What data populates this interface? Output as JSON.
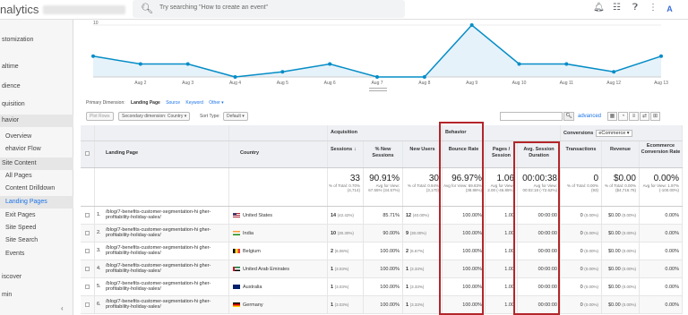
{
  "app": {
    "title": "nalytics",
    "search_placeholder": "Try searching \"How to create an event\"",
    "avatar_initials": "A"
  },
  "sidebar": {
    "items": [
      {
        "label": "stomization",
        "type": "item"
      },
      {
        "label": "altime",
        "type": "item"
      },
      {
        "label": "dience",
        "type": "item"
      },
      {
        "label": "quisition",
        "type": "item"
      },
      {
        "label": "havior",
        "type": "section"
      },
      {
        "label": "Overview",
        "type": "sub"
      },
      {
        "label": "ehavior Flow",
        "type": "sub"
      },
      {
        "label": "Site Content",
        "type": "section"
      },
      {
        "label": "All Pages",
        "type": "sub2"
      },
      {
        "label": "Content Drilldown",
        "type": "sub2"
      },
      {
        "label": "Landing Pages",
        "type": "active"
      },
      {
        "label": "Exit Pages",
        "type": "sub2"
      },
      {
        "label": "Site Speed",
        "type": "sub"
      },
      {
        "label": "Site Search",
        "type": "sub"
      },
      {
        "label": "Events",
        "type": "sub"
      },
      {
        "label": "iscover",
        "type": "item"
      },
      {
        "label": "min",
        "type": "item"
      }
    ]
  },
  "chart_data": {
    "type": "line",
    "categories": [
      "",
      "Aug 2",
      "Aug 3",
      "Aug 4",
      "Aug 5",
      "Aug 6",
      "Aug 7",
      "Aug 8",
      "Aug 9",
      "Aug 10",
      "Aug 11",
      "Aug 12",
      "Aug 13"
    ],
    "values": [
      4,
      2.5,
      2.5,
      0,
      1,
      2.5,
      0,
      0,
      10,
      2.5,
      2.5,
      1,
      4
    ],
    "ytick": "10",
    "ylim": [
      0,
      10
    ],
    "color": "#058dc7",
    "fill": "#e6f2f9"
  },
  "controls": {
    "primary_dimension": "Primary Dimension:",
    "landing_page": "Landing Page",
    "source": "Source",
    "keyword": "Keyword",
    "other": "Other ▾",
    "plot_rows": "Plot Rows",
    "secondary_dimension": "Secondary dimension: Country ▾",
    "sort_type_label": "Sort Type:",
    "sort_type_value": "Default ▾",
    "advanced": "advanced"
  },
  "table": {
    "headers": {
      "landing_page": "Landing Page",
      "country": "Country",
      "acquisition": "Acquisition",
      "behavior": "Behavior",
      "conversions": "Conversions",
      "ecommerce_sel": "eCommerce ▾",
      "sessions": "Sessions",
      "new_sessions": "% New Sessions",
      "new_users": "New Users",
      "bounce_rate": "Bounce Rate",
      "pages_session": "Pages / Session",
      "avg_session": "Avg. Session Duration",
      "transactions": "Transactions",
      "revenue": "Revenue",
      "ecommerce_rate": "Ecommerce Conversion Rate"
    },
    "totals": {
      "sessions": {
        "value": "33",
        "sub": "% of Total: 0.70% (4,714)"
      },
      "new_sessions": {
        "value": "90.91%",
        "sub": "Avg for View: 67.55% (34.57%)"
      },
      "new_users": {
        "value": "30",
        "sub": "% of Total: 0.94% (3,170)"
      },
      "bounce_rate": {
        "value": "96.97%",
        "sub": "Avg for View: 69.83% (38.86%)"
      },
      "pages_session": {
        "value": "1.06",
        "sub": "Avg for View: 2.00 (-46.85%)"
      },
      "avg_session": {
        "value": "00:00:38",
        "sub": "Avg for View: 00:02:18 (-72.62%)"
      },
      "transactions": {
        "value": "0",
        "sub": "% of Total: 0.00% (93)"
      },
      "revenue": {
        "value": "$0.00",
        "sub": "% of Total: 0.00% ($4,716.76)"
      },
      "ecommerce_rate": {
        "value": "0.00%",
        "sub": "Avg for View: 1.97% (-100.00%)"
      }
    },
    "rows": [
      {
        "num": "1.",
        "page": "/blog/7-benefits-customer-segmentation-hi gher-profitability-holiday-sales/",
        "country": "United States",
        "flag": "us",
        "sessions": "14",
        "sessions_pct": "(42.42%)",
        "new_sessions": "85.71%",
        "new_users": "12",
        "new_users_pct": "(40.00%)",
        "bounce": "100.00%",
        "pages": "1.00",
        "duration": "00:00:00",
        "trans": "0",
        "trans_pct": "(0.00%)",
        "rev": "$0.00",
        "rev_pct": "(0.00%)",
        "ecom": "0.00%"
      },
      {
        "num": "2.",
        "page": "/blog/7-benefits-customer-segmentation-hi gher-profitability-holiday-sales/",
        "country": "India",
        "flag": "in",
        "sessions": "10",
        "sessions_pct": "(30.30%)",
        "new_sessions": "90.00%",
        "new_users": "9",
        "new_users_pct": "(30.00%)",
        "bounce": "100.00%",
        "pages": "1.00",
        "duration": "00:00:00",
        "trans": "0",
        "trans_pct": "(0.00%)",
        "rev": "$0.00",
        "rev_pct": "(0.00%)",
        "ecom": "0.00%"
      },
      {
        "num": "3.",
        "page": "/blog/7-benefits-customer-segmentation-hi gher-profitability-holiday-sales/",
        "country": "Belgium",
        "flag": "be",
        "sessions": "2",
        "sessions_pct": "(6.06%)",
        "new_sessions": "100.00%",
        "new_users": "2",
        "new_users_pct": "(6.67%)",
        "bounce": "100.00%",
        "pages": "1.00",
        "duration": "00:00:00",
        "trans": "0",
        "trans_pct": "(0.00%)",
        "rev": "$0.00",
        "rev_pct": "(0.00%)",
        "ecom": "0.00%"
      },
      {
        "num": "4.",
        "page": "/blog/7-benefits-customer-segmentation-hi gher-profitability-holiday-sales/",
        "country": "United Arab Emirates",
        "flag": "ae",
        "sessions": "1",
        "sessions_pct": "(3.03%)",
        "new_sessions": "100.00%",
        "new_users": "1",
        "new_users_pct": "(3.33%)",
        "bounce": "100.00%",
        "pages": "1.00",
        "duration": "00:00:00",
        "trans": "0",
        "trans_pct": "(0.00%)",
        "rev": "$0.00",
        "rev_pct": "(0.00%)",
        "ecom": "0.00%"
      },
      {
        "num": "5.",
        "page": "/blog/7-benefits-customer-segmentation-hi gher-profitability-holiday-sales/",
        "country": "Australia",
        "flag": "au",
        "sessions": "1",
        "sessions_pct": "(3.03%)",
        "new_sessions": "100.00%",
        "new_users": "1",
        "new_users_pct": "(3.33%)",
        "bounce": "100.00%",
        "pages": "1.00",
        "duration": "00:00:00",
        "trans": "0",
        "trans_pct": "(0.00%)",
        "rev": "$0.00",
        "rev_pct": "(0.00%)",
        "ecom": "0.00%"
      },
      {
        "num": "6.",
        "page": "/blog/7-benefits-customer-segmentation-hi gher-profitability-holiday-sales/",
        "country": "Germany",
        "flag": "de",
        "sessions": "1",
        "sessions_pct": "(3.03%)",
        "new_sessions": "100.00%",
        "new_users": "1",
        "new_users_pct": "(3.33%)",
        "bounce": "100.00%",
        "pages": "1.00",
        "duration": "00:00:00",
        "trans": "0",
        "trans_pct": "(0.00%)",
        "rev": "$0.00",
        "rev_pct": "(0.00%)",
        "ecom": "0.00%"
      }
    ]
  },
  "colors": {
    "highlight": "#b3262a",
    "link": "#1a73e8",
    "line": "#058dc7"
  }
}
